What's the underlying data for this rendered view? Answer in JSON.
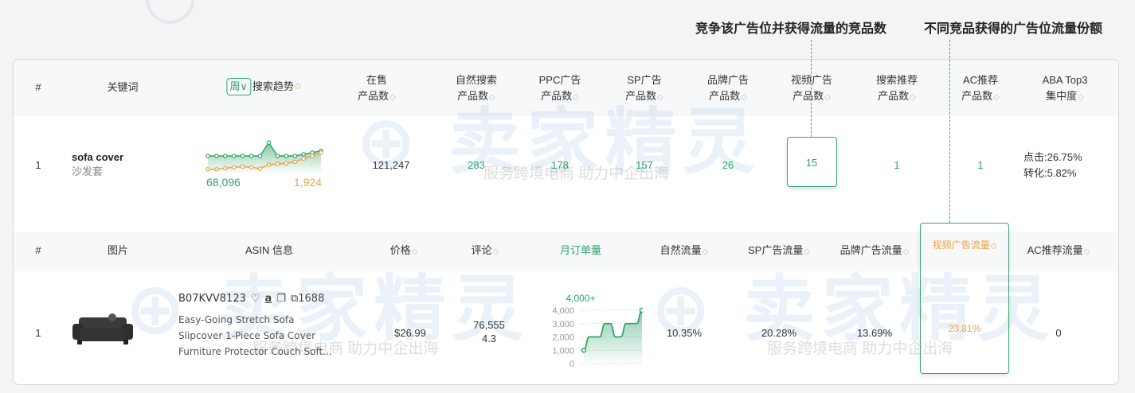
{
  "annotations": {
    "left": "竞争该广告位并获得流量的竞品数",
    "right": "不同竞品获得的广告位流量份额"
  },
  "watermark": {
    "logo": "卖家精灵",
    "slogan": "服务跨境电商 助力中企出海"
  },
  "keyword_table": {
    "headers": {
      "index": "#",
      "keyword": "关键词",
      "period": "周",
      "trend": "搜索趋势",
      "on_sale": [
        "在售",
        "产品数"
      ],
      "organic": [
        "自然搜索",
        "产品数"
      ],
      "ppc": [
        "PPC广告",
        "产品数"
      ],
      "sp": [
        "SP广告",
        "产品数"
      ],
      "brand": [
        "品牌广告",
        "产品数"
      ],
      "video": [
        "视频广告",
        "产品数"
      ],
      "search_rec": [
        "搜索推荐",
        "产品数"
      ],
      "ac": [
        "AC推荐",
        "产品数"
      ],
      "aba": [
        "ABA Top3",
        "集中度"
      ]
    },
    "row": {
      "index": "1",
      "keyword": "sofa cover",
      "keyword_cn": "沙发套",
      "trend_left": "68,096",
      "trend_right": "1,924",
      "on_sale": "121,247",
      "organic": "283",
      "ppc": "178",
      "sp": "157",
      "brand": "26",
      "video": "15",
      "search_rec": "1",
      "ac": "1",
      "aba_click": "点击:26.75%",
      "aba_conv": "转化:5.82%"
    }
  },
  "product_table": {
    "headers": {
      "index": "#",
      "image": "图片",
      "asin": "ASIN 信息",
      "price": "价格",
      "reviews": "评论",
      "monthly": "月订单量",
      "organic": "自然流量",
      "sp": "SP广告流量",
      "brand": "品牌广告流量",
      "video": "视频广告流量",
      "ac": "AC推荐流量"
    },
    "row": {
      "index": "1",
      "asin": "B07KVV8123",
      "link_1688": "1688",
      "title_lines": [
        "Easy-Going Stretch Sofa",
        "Slipcover 1-Piece Sofa Cover",
        "Furniture Protector Couch Soft..."
      ],
      "price": "$26.99",
      "reviews": "76,555",
      "rating": "4.3",
      "monthly_label": "4,000+",
      "organic": "10.35%",
      "sp": "20.28%",
      "brand": "13.69%",
      "video": "23.81%",
      "ac": "0"
    }
  },
  "chart_data": [
    {
      "type": "line",
      "title": "搜索趋势",
      "series": [
        {
          "name": "search volume",
          "color": "#2fa36b",
          "values": [
            5,
            5,
            5,
            5,
            5,
            5,
            5,
            9,
            5,
            5,
            5,
            5.5,
            6,
            6.5
          ]
        },
        {
          "name": "rank",
          "color": "#f0a040",
          "values": [
            1,
            1,
            1.3,
            1.6,
            1.8,
            1.6,
            1.2,
            2.4,
            2.6,
            2.8,
            3.2,
            4.2,
            5,
            6
          ]
        }
      ]
    },
    {
      "type": "line",
      "title": "月订单量",
      "yticks": [
        "4,000",
        "3,000",
        "2,000",
        "1,000",
        "0"
      ],
      "ylim": [
        0,
        4000
      ],
      "series": [
        {
          "name": "monthly orders",
          "color": "#2fa36b",
          "values": [
            1000,
            2000,
            2000,
            2000,
            3000,
            3000,
            2000,
            2000,
            3000,
            3000,
            3000,
            4000
          ]
        }
      ]
    }
  ]
}
